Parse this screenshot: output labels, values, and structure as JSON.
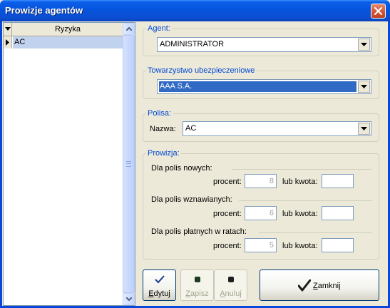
{
  "window": {
    "title": "Prowizje agentów"
  },
  "grid": {
    "column_header": "Ryzyka",
    "rows": [
      "AC"
    ]
  },
  "agent": {
    "group_label": "Agent:",
    "value": "ADMINISTRATOR"
  },
  "company": {
    "group_label": "Towarzystwo ubezpieczeniowe",
    "value": "AAA S.A."
  },
  "policy": {
    "group_label": "Polisa:",
    "name_label": "Nazwa:",
    "value": "AC"
  },
  "commission": {
    "group_label": "Prowizja:",
    "sections": [
      {
        "label": "Dla polis nowych:",
        "percent_label": "procent:",
        "percent": "8",
        "amount_label": "lub kwota:",
        "amount": ""
      },
      {
        "label": "Dla polis wznawianych:",
        "percent_label": "procent:",
        "percent": "6",
        "amount_label": "lub kwota:",
        "amount": ""
      },
      {
        "label": "Dla polis płatnych w ratach:",
        "percent_label": "procent:",
        "percent": "5",
        "amount_label": "lub kwota:",
        "amount": ""
      }
    ]
  },
  "buttons": {
    "edit": {
      "key": "E",
      "rest": "dytuj",
      "enabled": true
    },
    "save": {
      "key": "Z",
      "rest": "apisz",
      "enabled": false
    },
    "cancel": {
      "key": "A",
      "rest": "nuluj",
      "enabled": false
    },
    "close": {
      "key": "Z",
      "rest": "amknij"
    }
  },
  "colors": {
    "title_bar": "#0654dd",
    "group_label": "#0046d5",
    "selection": "#316ac5",
    "grid_selected_row": "#c1d2ee"
  }
}
